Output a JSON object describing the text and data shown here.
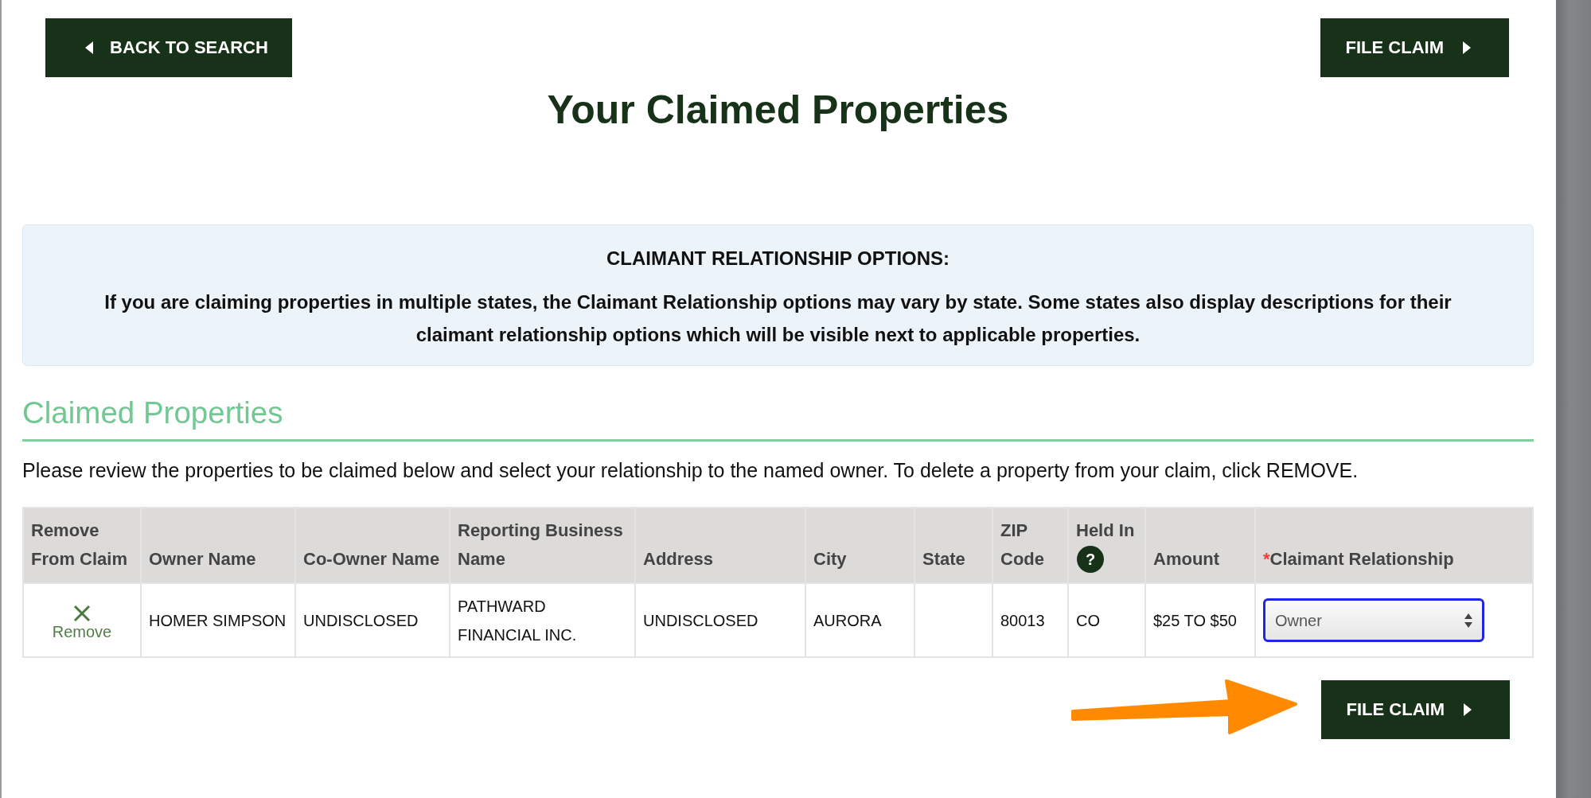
{
  "header_buttons": [
    {
      "kind": "back",
      "label": "BACK TO SEARCH"
    },
    {
      "kind": "submit",
      "label": "FILE CLAIM"
    }
  ],
  "page_title": "Your Claimed Properties",
  "notice": {
    "title": "CLAIMANT RELATIONSHIP OPTIONS:",
    "text": "If you are claiming properties in multiple states, the Claimant Relationship options may vary by state. Some states also display descriptions for their claimant relationship options which will be visible next to applicable properties."
  },
  "section": {
    "heading": "Claimed Properties",
    "instructions": "Please review the properties to be claimed below and select your relationship to the named owner. To delete a property from your claim, click REMOVE."
  },
  "table": {
    "columns": [
      {
        "label": "Remove From Claim"
      },
      {
        "label": "Owner Name"
      },
      {
        "label": "Co-Owner Name"
      },
      {
        "label": "Reporting Business Name"
      },
      {
        "label": "Address"
      },
      {
        "label": "City"
      },
      {
        "label": "State"
      },
      {
        "label": "ZIP Code"
      },
      {
        "label": "Held In",
        "help": "?"
      },
      {
        "label": "Amount"
      },
      {
        "label": "Claimant Relationship",
        "required_mark": "*"
      }
    ],
    "rows": [
      {
        "remove_label": "Remove",
        "owner_name": "HOMER SIMPSON",
        "co_owner_name": "UNDISCLOSED",
        "reporting_business_name": "PATHWARD FINANCIAL INC.",
        "address": "UNDISCLOSED",
        "city": "AURORA",
        "zip_code": "80013",
        "held_in": "CO",
        "amount": "$25 TO $50",
        "claimant_relationship": {
          "value": "Owner",
          "focused": true
        }
      }
    ]
  },
  "footer_buttons": [
    {
      "kind": "submit",
      "label": "FILE CLAIM"
    }
  ]
}
